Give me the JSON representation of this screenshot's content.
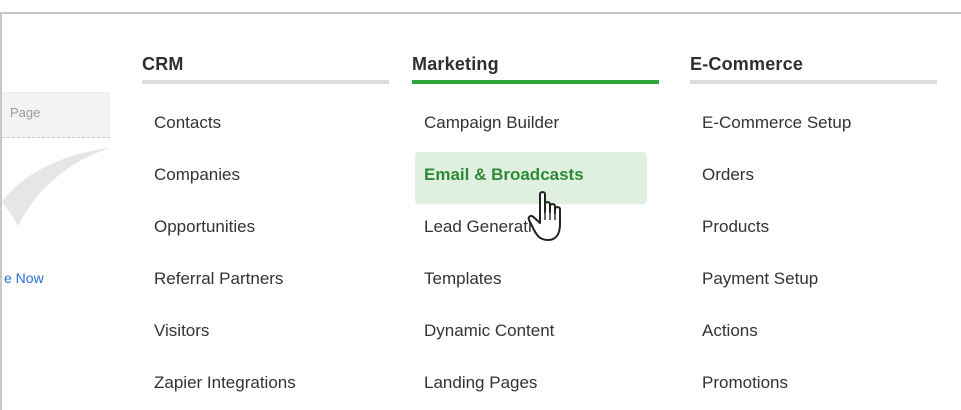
{
  "background": {
    "page_label": "Page",
    "link_fragment": "e Now"
  },
  "menu": {
    "columns": [
      {
        "title": "CRM",
        "items": [
          "Contacts",
          "Companies",
          "Opportunities",
          "Referral Partners",
          "Visitors",
          "Zapier Integrations"
        ]
      },
      {
        "title": "Marketing",
        "items": [
          "Campaign Builder",
          "Email & Broadcasts",
          "Lead Generation",
          "Templates",
          "Dynamic Content",
          "Landing Pages"
        ]
      },
      {
        "title": "E-Commerce",
        "items": [
          "E-Commerce Setup",
          "Orders",
          "Products",
          "Payment Setup",
          "Actions",
          "Promotions"
        ]
      }
    ],
    "active_item": "Email & Broadcasts"
  },
  "colors": {
    "active_text": "#2e8a36",
    "active_bg": "#e0f0e0",
    "marketing_underline": "#2fa63c",
    "link": "#2b6fd6"
  },
  "cursor": "hand-pointer-icon"
}
